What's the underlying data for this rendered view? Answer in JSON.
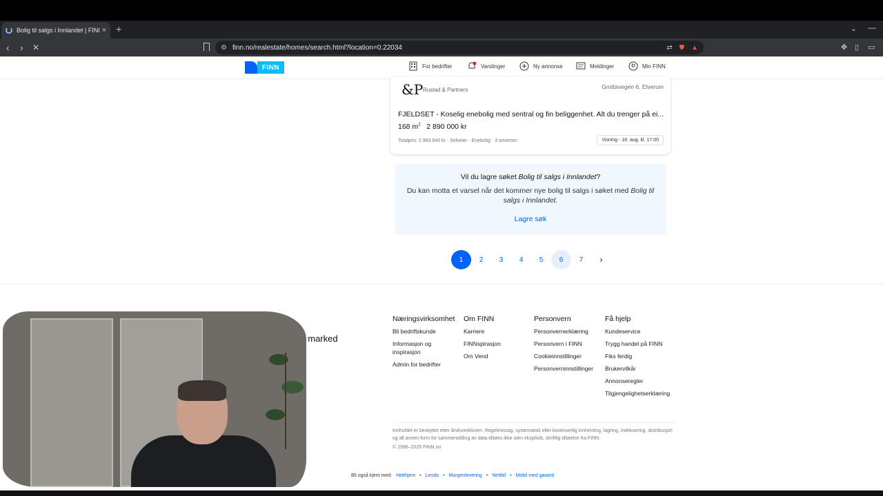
{
  "browser": {
    "tab_title": "Bolig til salgs i Innlandet | FINN",
    "tab_close": "×",
    "new_tab": "+",
    "url": "finn.no/realestate/homes/search.html?location=0.22034"
  },
  "header": {
    "logo_text": "FINN",
    "nav": [
      {
        "label": "For bedrifter",
        "icon": "building-icon"
      },
      {
        "label": "Varslinger",
        "icon": "bell-icon"
      },
      {
        "label": "Ny annonse",
        "icon": "plus-circle-icon"
      },
      {
        "label": "Meldinger",
        "icon": "chat-icon"
      },
      {
        "label": "Min FINN",
        "icon": "user-circle-icon"
      }
    ]
  },
  "listing": {
    "brand_mark": "&P",
    "brand": "Rustad & Partners",
    "address": "Grottavegen 6, Elverum",
    "title": "FJELDSET - Koselig enebolig med sentral og fin beliggenhet. Alt du trenger på ei...",
    "size": "168 m",
    "size_unit_sup": "2",
    "price": "2 890 000 kr",
    "meta": "Totalpris: 2 963 640 kr · Selveier · Enebolig · 3 soverom",
    "viewing": "Visning - 18. aug. kl. 17:00"
  },
  "save_search": {
    "question_prefix": "Vil du lagre søket ",
    "question_em": "Bolig til salgs i Innlandet",
    "question_suffix": "?",
    "desc_prefix": "Du kan motta et varsel når det kommer nye bolig til salgs i søket med ",
    "desc_em": "Bolig til salgs i Innlandet.",
    "link": "Lagre søk"
  },
  "pagination": {
    "pages": [
      "1",
      "2",
      "3",
      "4",
      "5",
      "6",
      "7"
    ],
    "current": "1",
    "next": "›"
  },
  "footer": {
    "tagline": "...tenes marked",
    "columns": [
      {
        "heading": "Næringsvirksomhet",
        "links": [
          "Bli bedriftskunde",
          "Informasjon og inspirasjon",
          "Admin for bedrifter"
        ]
      },
      {
        "heading": "Om FINN",
        "links": [
          "Karriere",
          "FINNspirasjon",
          "Om Vend"
        ]
      },
      {
        "heading": "Personvern",
        "links": [
          "Personvernerklæring",
          "Personvern i FINN",
          "Cookieinnstillinger",
          "Personverninnstillinger"
        ]
      },
      {
        "heading": "Få hjelp",
        "links": [
          "Kundeservice",
          "Trygg handel på FINN",
          "Fiks ferdig",
          "Brukervilkår",
          "Annonseregler",
          "Tilgjengelighetserklæring"
        ]
      }
    ],
    "legal": "Innholdet er beskyttet etter åndsverkloven. Regelmessig, systematisk eller kontinuerlig innhenting, lagring, indeksering, distribusjon og all annen form for sammenstilling av data tillates ikke uten eksplisitt, skriftlig tillatelse fra FINN.",
    "copyright": "© 1996–2026 FINN.no",
    "also_label": "Bli også kjent med:",
    "also_links": [
      "Hetthjem",
      "Lendo",
      "Morgenlevering",
      "Nettbil",
      "Mobil med garanti"
    ]
  },
  "colors": {
    "brand_blue": "#0063fb",
    "brand_cyan": "#06befb",
    "save_bg": "#f1f8fd"
  }
}
